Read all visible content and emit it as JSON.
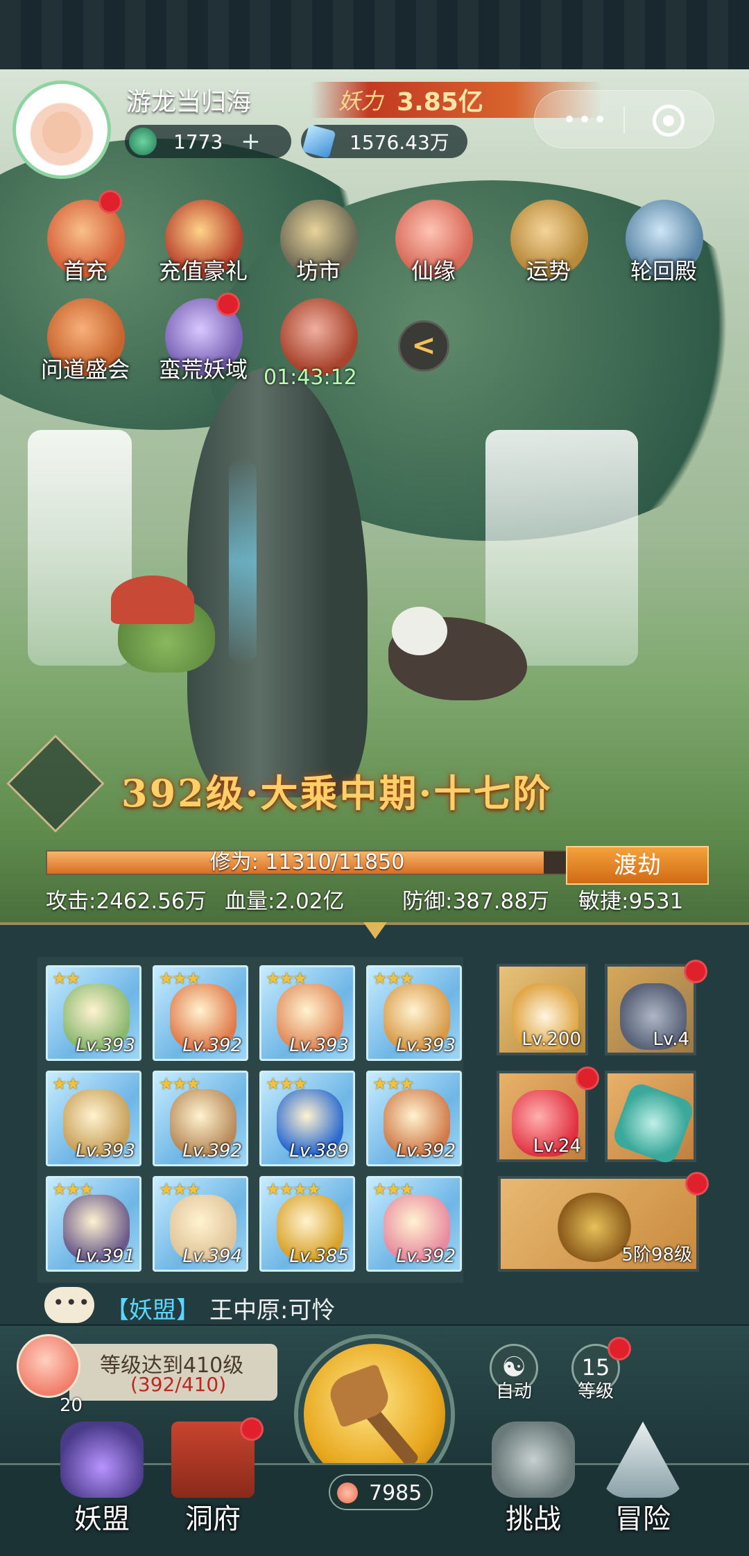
{
  "player": {
    "name": "游龙当归海",
    "power_label": "妖力",
    "power_value": "3.85亿",
    "jade": "1773",
    "jade_plus": "+",
    "crystal": "1576.43万"
  },
  "activities": [
    {
      "label": "首充",
      "icon": "first-charge-icon",
      "color": "#d6613a"
    },
    {
      "label": "充值豪礼",
      "icon": "gift-bag-icon",
      "color": "#b9442e"
    },
    {
      "label": "坊市",
      "icon": "market-coin-icon",
      "color": "#6e6a55"
    },
    {
      "label": "仙缘",
      "icon": "lotus-icon",
      "color": "#d86a5a"
    },
    {
      "label": "运势",
      "icon": "fortune-sticks-icon",
      "color": "#b88a3a"
    },
    {
      "label": "轮回殿",
      "icon": "reincarnation-hall-icon",
      "color": "#5b86a6"
    },
    {
      "label": "问道盛会",
      "icon": "dao-assembly-icon",
      "color": "#c8642e"
    },
    {
      "label": "蛮荒妖域",
      "icon": "wild-realm-icon",
      "color": "#7a62b4"
    }
  ],
  "timer": "01:43:12",
  "collapse_glyph": "<",
  "realm": "392级·大乘中期·十七阶",
  "cultivation": {
    "label": "修为:",
    "value": "11310/11850",
    "current": 11310,
    "max": 11850
  },
  "dujie_label": "渡劫",
  "stats": {
    "attack": "攻击:2462.56万",
    "hp": "血量:2.02亿",
    "defense": "防御:387.88万",
    "agility": "敏捷:9531"
  },
  "equipment": [
    {
      "stars": "★★",
      "level": "Lv.393",
      "color": "#8ab870"
    },
    {
      "stars": "★★★",
      "level": "Lv.392",
      "color": "#e07a4a"
    },
    {
      "stars": "★★★",
      "level": "Lv.393",
      "color": "#e08a5a"
    },
    {
      "stars": "★★★",
      "level": "Lv.393",
      "color": "#d89a4a"
    },
    {
      "stars": "★★",
      "level": "Lv.393",
      "color": "#c8a05a"
    },
    {
      "stars": "★★★",
      "level": "Lv.392",
      "color": "#b88a5a"
    },
    {
      "stars": "★★★",
      "level": "Lv.389",
      "color": "#2a6ad0"
    },
    {
      "stars": "★★★",
      "level": "Lv.392",
      "color": "#d07a4a"
    },
    {
      "stars": "★★★",
      "level": "Lv.391",
      "color": "#6a5a8a"
    },
    {
      "stars": "★★★",
      "level": "Lv.394",
      "color": "#e0c49a"
    },
    {
      "stars": "★★★★",
      "level": "Lv.385",
      "color": "#d8a22a"
    },
    {
      "stars": "★★★",
      "level": "Lv.392",
      "color": "#e88aa0"
    }
  ],
  "side_slots": {
    "pet_level": "Lv.200",
    "beast_level": "Lv.4",
    "orb_level": "Lv.24",
    "treasure_level": "5阶98级"
  },
  "chat": {
    "channel": "【妖盟】",
    "message": "王中原:可怜"
  },
  "goal": {
    "title": "等级达到410级",
    "progress": "(392/410)",
    "peach_count": "20"
  },
  "peach_total": "7985",
  "auto_label": "自动",
  "auto_icon": "auto-swirl-icon",
  "level_label": "等级",
  "level_value": "15",
  "nav": {
    "alliance": "妖盟",
    "cave": "洞府",
    "challenge": "挑战",
    "adventure": "冒险"
  },
  "colors": {
    "accent_gold": "#ffd06a",
    "red_dot": "#e0202a",
    "xp_fill": "#d86e22"
  }
}
